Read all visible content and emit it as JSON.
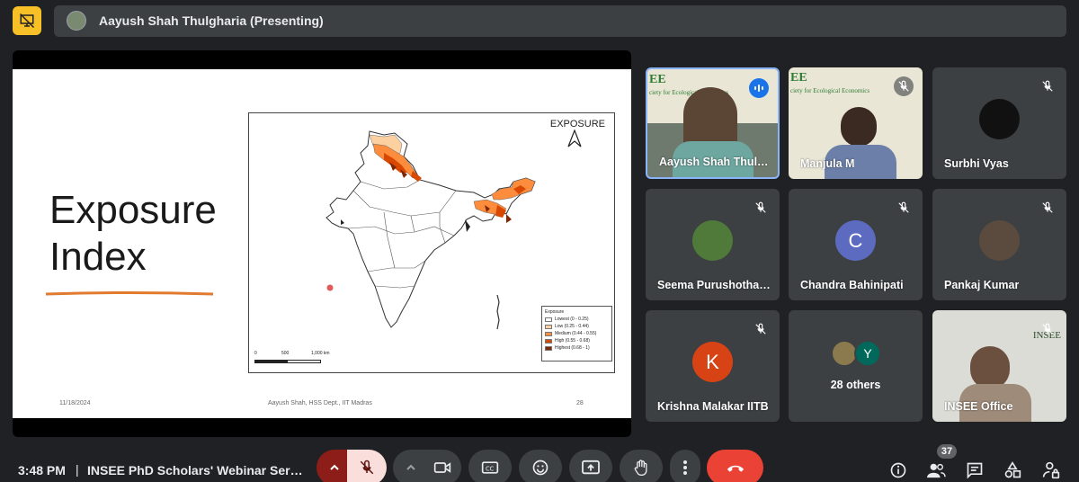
{
  "presenter_bar": {
    "name": "Aayush Shah Thulgharia (Presenting)"
  },
  "slide": {
    "title_line1": "Exposure",
    "title_line2": "Index",
    "map_title": "EXPOSURE",
    "legend": {
      "heading": "Exposure",
      "items": [
        {
          "label": "Lowest (0 - 0.25)",
          "color": "#ffffff"
        },
        {
          "label": "Low (0.25 - 0.44)",
          "color": "#fdd0a2"
        },
        {
          "label": "Medium (0.44 - 0.55)",
          "color": "#fd8d3c"
        },
        {
          "label": "High (0.55 - 0.68)",
          "color": "#d94801"
        },
        {
          "label": "Highest (0.68 - 1)",
          "color": "#7f2704"
        }
      ]
    },
    "scale": {
      "t0": "0",
      "t1": "500",
      "t2": "1,000 km"
    },
    "date": "11/18/2024",
    "author": "Aayush Shah, HSS Dept., IIT Madras",
    "page": "28"
  },
  "participants": [
    {
      "name": "Aayush Shah Thulgharia",
      "state": "speaking"
    },
    {
      "name": "Manjula M",
      "state": "muted"
    },
    {
      "name": "Surbhi Vyas",
      "state": "muted"
    },
    {
      "name": "Seema Purushothaman",
      "state": "muted"
    },
    {
      "name": "Chandra Bahinipati",
      "state": "muted",
      "initial": "C",
      "avatar_color": "#5c6bc0"
    },
    {
      "name": "Pankaj Kumar",
      "state": "muted"
    },
    {
      "name": "Krishna Malakar IITB",
      "state": "muted",
      "initial": "K",
      "avatar_color": "#d84315"
    },
    {
      "name": "28 others",
      "extra_initial": "Y",
      "extra_color": "#00695c"
    },
    {
      "name": "INSEE Office",
      "state": "muted"
    }
  ],
  "tile_backdrop": {
    "line1": "EE",
    "line2": "ciety for Ecological Economics"
  },
  "bottom": {
    "time": "3:48 PM",
    "separator": "|",
    "meeting": "INSEE PhD Scholars' Webinar Series",
    "people_count": "37"
  },
  "colors": {
    "accent": "#8ab4f8",
    "end_call": "#ea4335",
    "mic_off_bg": "#f9dedc",
    "layout_btn": "#f6c026"
  }
}
